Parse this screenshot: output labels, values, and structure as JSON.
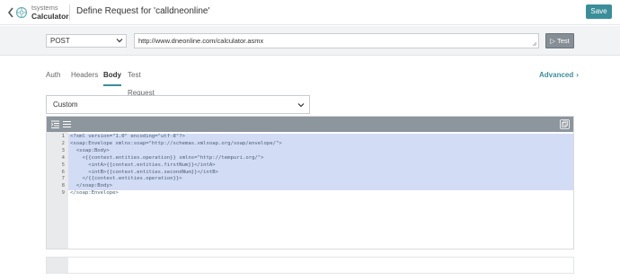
{
  "header": {
    "app_name": "tsystems",
    "app_subtitle": "Calculator",
    "page_title": "Define Request for 'calldneonline'",
    "save_label": "Save"
  },
  "request": {
    "method": "POST",
    "url": "http://www.dneonline.com/calculator.asmx",
    "test_label": "Test"
  },
  "tabs": [
    {
      "label": "Auth",
      "active": false
    },
    {
      "label": "Headers",
      "active": false
    },
    {
      "label": "Body",
      "active": true
    },
    {
      "label": "Test Request",
      "active": false
    }
  ],
  "advanced_label": "Advanced",
  "body_type": "Custom",
  "editor": {
    "line_numbers": [
      "1",
      "2",
      "3",
      "4",
      "5",
      "6",
      "7",
      "8",
      "9"
    ],
    "lines": [
      "<?xml version=\"1.0\" encoding=\"utf-8\"?>",
      "<soap:Envelope xmlns:soap=\"http://schemas.xmlsoap.org/soap/envelope/\">",
      "  <soap:Body>",
      "    <{{context.entities.operation}} xmlns=\"http://tempuri.org/\">",
      "      <intA>{{context.entities.firstNum}}</intA>",
      "      <intB>{{context.entities.secondNum}}</intB>",
      "    </{{context.entities.operation}}>",
      "  </soap:Body>",
      "</soap:Envelope>"
    ]
  },
  "colors": {
    "accent": "#3b8e99",
    "toolbar": "#8d959d",
    "selection": "#d3dcf5"
  }
}
